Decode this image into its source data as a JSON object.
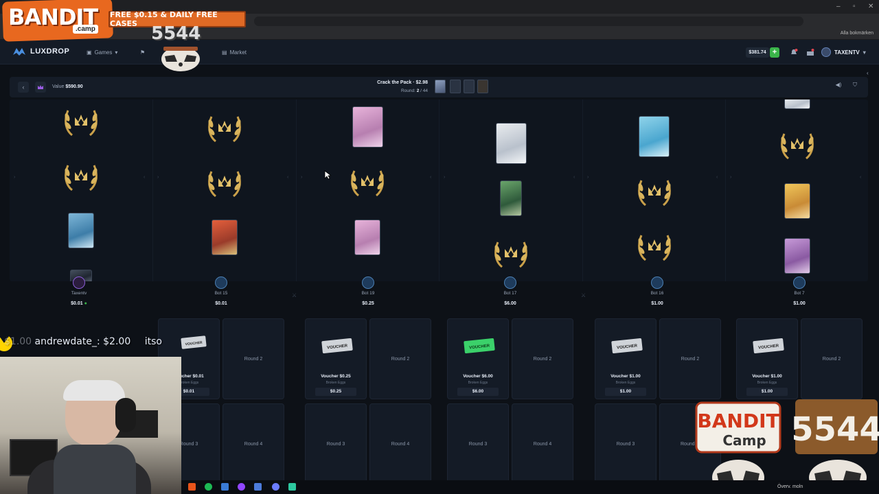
{
  "browser": {
    "window_controls": [
      "–",
      "▫",
      "✕"
    ],
    "bookmarks_label": "Alla bokmärken"
  },
  "nav": {
    "logo_text": "LUXDROP",
    "links": [
      {
        "label": "Games",
        "icon": "gamepad-icon"
      },
      {
        "label": "Market",
        "icon": "cart-icon"
      }
    ],
    "balance": "$381.74",
    "deposit_label": "+",
    "notification_count": "1",
    "username": "TAXENTV"
  },
  "battle": {
    "back_label": "‹",
    "value_label": "Value",
    "value_amount": "$590.90",
    "pack_title": "Crack the Pack · $2.98",
    "round_prefix": "Round:",
    "round_current": "2",
    "round_total": "/ 44"
  },
  "players": [
    {
      "name": "Taxentv",
      "amount": "$0.01",
      "verified": true
    },
    {
      "name": "Bot 15",
      "amount": "$0.01"
    },
    {
      "name": "Bot 19",
      "amount": "$0.25"
    },
    {
      "name": "Bot 17",
      "amount": "$6.00"
    },
    {
      "name": "Bot 16",
      "amount": "$1.00"
    },
    {
      "name": "Bot 7",
      "amount": "$1.00"
    }
  ],
  "vouchers": [
    {
      "name": "Voucher $0.01",
      "sub": "Broken Eggs",
      "price": "$0.01"
    },
    {
      "name": "Voucher $0.25",
      "sub": "Broken Eggs",
      "price": "$0.25"
    },
    {
      "name": "Voucher $6.00",
      "sub": "Broken Eggs",
      "price": "$6.00"
    },
    {
      "name": "Voucher $1.00",
      "sub": "Broken Eggs",
      "price": "$1.00"
    },
    {
      "name": "Voucher $1.00",
      "sub": "Broken Eggs",
      "price": "$1.00"
    }
  ],
  "round_labels": {
    "round2": "Round 2",
    "round3": "Round 3",
    "round4": "Round 4",
    "round_partial": "Round"
  },
  "overlay": {
    "promo": "FREE $0.15 & DAILY FREE CASES",
    "bandit_logo": "BANDIT",
    "bandit_camp": ".camp",
    "bandit_num": "5544",
    "bandit_logo_br": "BANDIT",
    "bandit_camp_br": "Camp",
    "chat_amount_1": "$1.00",
    "chat_user_1": "andrewdate_",
    "chat_amount_2": "$2.00",
    "chat_user_2": "itso",
    "voucher_tag": "VOUCHER",
    "tray_text": "Överv. moln"
  },
  "colors": {
    "accent_green": "#3bb54a",
    "page_bg": "#0d1117",
    "laurel_gold": "#c9a04a"
  }
}
